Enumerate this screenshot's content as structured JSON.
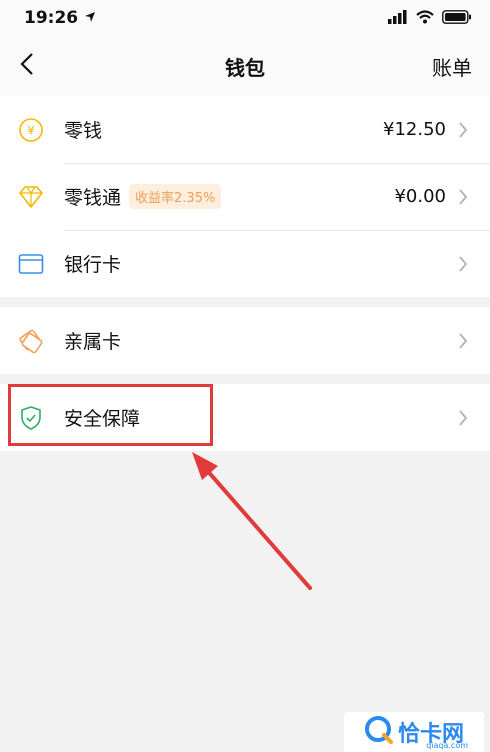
{
  "status_bar": {
    "time": "19:26"
  },
  "nav": {
    "title": "钱包",
    "action": "账单"
  },
  "groups": [
    [
      {
        "label": "零钱",
        "value": "¥12.50",
        "icon": "coin-icon"
      },
      {
        "label": "零钱通",
        "badge": "收益率2.35%",
        "value": "¥0.00",
        "icon": "diamond-icon"
      },
      {
        "label": "银行卡",
        "icon": "bank-card-icon"
      }
    ],
    [
      {
        "label": "亲属卡",
        "icon": "family-card-icon"
      }
    ],
    [
      {
        "label": "安全保障",
        "icon": "shield-icon"
      }
    ]
  ],
  "watermark": {
    "text": "恰卡网",
    "sub": "qiaqa.com"
  },
  "colors": {
    "accent_yellow": "#f5b800",
    "accent_blue": "#3a8ee6",
    "accent_green": "#2aae67",
    "accent_orange": "#f0a25c",
    "annotation_red": "#e03b3b"
  }
}
